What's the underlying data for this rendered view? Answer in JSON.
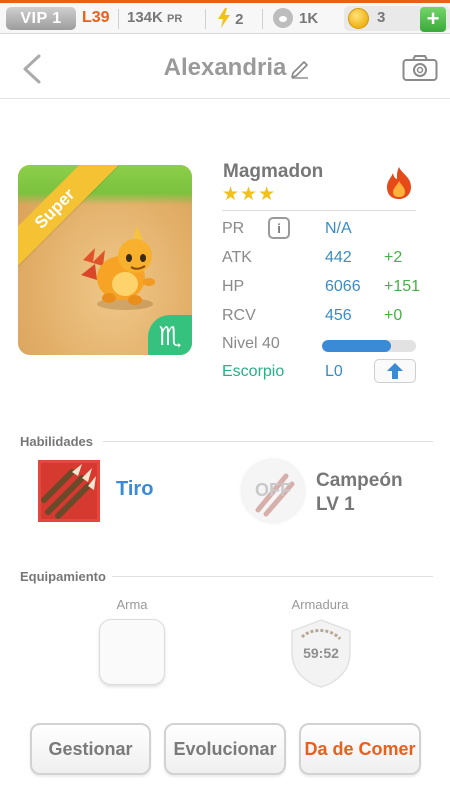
{
  "status_bar": {
    "vip": "VIP 1",
    "level": "L39",
    "power": "134K",
    "power_unit": "PR",
    "energy": "2",
    "paws": "1K",
    "coins": "3",
    "add_label": "+",
    "accent_color": "#e8601c"
  },
  "header": {
    "title": "Alexandria"
  },
  "monster": {
    "name": "Magmadon",
    "stars": "★★★",
    "rarity_ribbon": "Super",
    "zodiac_glyph": "♏",
    "element": "fire",
    "stats": [
      {
        "label": "PR",
        "value": "N/A",
        "bonus": "",
        "info": "i"
      },
      {
        "label": "ATK",
        "value": "442",
        "bonus": "+2"
      },
      {
        "label": "HP",
        "value": "6066",
        "bonus": "+151"
      },
      {
        "label": "RCV",
        "value": "456",
        "bonus": "+0"
      }
    ],
    "level_label": "Nivel 40",
    "level_progress": 0.73,
    "zodiac_label": "Escorpio",
    "zodiac_level": "L0"
  },
  "skills": {
    "heading": "Habilidades",
    "primary": {
      "name": "Tiro"
    },
    "secondary": {
      "state": "OFF",
      "name_line1": "Campeón",
      "name_line2": "LV 1"
    }
  },
  "equipment": {
    "heading": "Equipamiento",
    "weapon_label": "Arma",
    "armor_label": "Armadura",
    "armor_timer": "59:52"
  },
  "actions": {
    "manage": "Gestionar",
    "evolve": "Evolucionar",
    "feed": "Da de Comer"
  },
  "colors": {
    "stat_value": "#3a8cc6",
    "stat_bonus": "#47b047",
    "zodiac": "#22b386",
    "feed_button": "#e8601c"
  }
}
